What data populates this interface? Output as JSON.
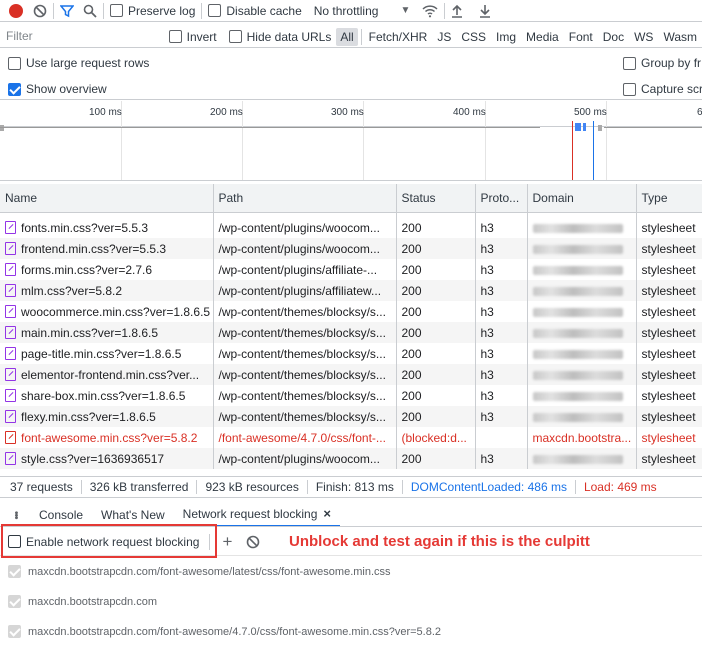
{
  "toolbar": {
    "preserve_log": "Preserve log",
    "disable_cache": "Disable cache",
    "throttling": "No throttling"
  },
  "filterbar": {
    "filter_placeholder": "Filter",
    "invert": "Invert",
    "hide_data_urls": "Hide data URLs",
    "types": [
      "All",
      "Fetch/XHR",
      "JS",
      "CSS",
      "Img",
      "Media",
      "Font",
      "Doc",
      "WS",
      "Wasm"
    ]
  },
  "options": {
    "large_rows": "Use large request rows",
    "show_overview": "Show overview",
    "group_by_frame": "Group by fr",
    "capture_screenshots": "Capture scre"
  },
  "overview": {
    "ticks": [
      "100 ms",
      "200 ms",
      "300 ms",
      "400 ms",
      "500 ms",
      "6"
    ]
  },
  "table": {
    "headers": [
      "Name",
      "Path",
      "Status",
      "Proto...",
      "Domain",
      "Type"
    ],
    "rows": [
      {
        "name": "fonts.min.css?ver=5.5.3",
        "path": "/wp-content/plugins/woocom...",
        "status": "200",
        "proto": "h3",
        "type": "stylesheet",
        "blocked": false
      },
      {
        "name": "frontend.min.css?ver=5.5.3",
        "path": "/wp-content/plugins/woocom...",
        "status": "200",
        "proto": "h3",
        "type": "stylesheet",
        "blocked": false
      },
      {
        "name": "forms.min.css?ver=2.7.6",
        "path": "/wp-content/plugins/affiliate-...",
        "status": "200",
        "proto": "h3",
        "type": "stylesheet",
        "blocked": false
      },
      {
        "name": "mlm.css?ver=5.8.2",
        "path": "/wp-content/plugins/affiliatew...",
        "status": "200",
        "proto": "h3",
        "type": "stylesheet",
        "blocked": false
      },
      {
        "name": "woocommerce.min.css?ver=1.8.6.5",
        "path": "/wp-content/themes/blocksy/s...",
        "status": "200",
        "proto": "h3",
        "type": "stylesheet",
        "blocked": false
      },
      {
        "name": "main.min.css?ver=1.8.6.5",
        "path": "/wp-content/themes/blocksy/s...",
        "status": "200",
        "proto": "h3",
        "type": "stylesheet",
        "blocked": false
      },
      {
        "name": "page-title.min.css?ver=1.8.6.5",
        "path": "/wp-content/themes/blocksy/s...",
        "status": "200",
        "proto": "h3",
        "type": "stylesheet",
        "blocked": false
      },
      {
        "name": "elementor-frontend.min.css?ver...",
        "path": "/wp-content/themes/blocksy/s...",
        "status": "200",
        "proto": "h3",
        "type": "stylesheet",
        "blocked": false
      },
      {
        "name": "share-box.min.css?ver=1.8.6.5",
        "path": "/wp-content/themes/blocksy/s...",
        "status": "200",
        "proto": "h3",
        "type": "stylesheet",
        "blocked": false
      },
      {
        "name": "flexy.min.css?ver=1.8.6.5",
        "path": "/wp-content/themes/blocksy/s...",
        "status": "200",
        "proto": "h3",
        "type": "stylesheet",
        "blocked": false
      },
      {
        "name": "font-awesome.min.css?ver=5.8.2",
        "path": "/font-awesome/4.7.0/css/font-...",
        "status": "(blocked:d...",
        "proto": "",
        "domain": "maxcdn.bootstra...",
        "type": "stylesheet",
        "blocked": true
      },
      {
        "name": "style.css?ver=1636936517",
        "path": "/wp-content/plugins/woocom...",
        "status": "200",
        "proto": "h3",
        "type": "stylesheet",
        "blocked": false
      }
    ]
  },
  "summary": {
    "requests": "37 requests",
    "transferred": "326 kB transferred",
    "resources": "923 kB resources",
    "finish": "Finish: 813 ms",
    "dcl": "DOMContentLoaded: 486 ms",
    "load": "Load: 469 ms",
    "dcl_color": "#1a73e8",
    "load_color": "#d93025"
  },
  "drawer": {
    "tabs": [
      "Console",
      "What's New",
      "Network request blocking"
    ],
    "close": "×",
    "enable_blocking": "Enable network request blocking",
    "add": "+",
    "annotation": "Unblock and test again if this is the culpitt",
    "patterns": [
      "maxcdn.bootstrapcdn.com/font-awesome/latest/css/font-awesome.min.css",
      "maxcdn.bootstrapcdn.com",
      "maxcdn.bootstrapcdn.com/font-awesome/4.7.0/css/font-awesome.min.css?ver=5.8.2"
    ]
  }
}
